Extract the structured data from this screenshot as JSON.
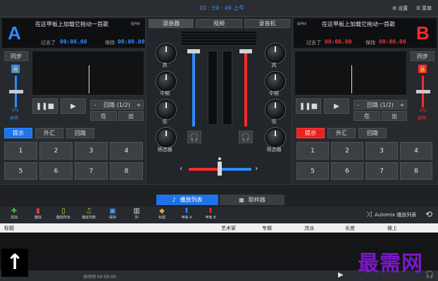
{
  "topbar": {
    "time": "10 : 59 : 49 上午",
    "settings_label": "设置",
    "menu_label": "菜单"
  },
  "deckA": {
    "letter": "A",
    "title": "在这甲板上加载它拖动一首歌",
    "bpm": "BPM",
    "elapsed_label": "过去了",
    "elapsed": "00:00.00",
    "remain_label": "保持",
    "remain": "00:00.00",
    "sync_label": "同步",
    "pitch": "0%",
    "pitch_label": "球场",
    "loop_label": "回路 (1/2)",
    "minus": "-",
    "plus": "+",
    "in_label": "在",
    "out_label": "出",
    "tabs": [
      "提示",
      "外汇",
      "回路"
    ],
    "pads": [
      "1",
      "2",
      "3",
      "4",
      "5",
      "6",
      "7",
      "8"
    ]
  },
  "deckB": {
    "letter": "B",
    "title": "在这甲板上加载它拖动一首歌",
    "bpm": "BPM",
    "elapsed_label": "过去了",
    "elapsed": "00:00.00",
    "remain_label": "保持",
    "remain": "00:00.00",
    "sync_label": "同步",
    "pitch": "0%",
    "pitch_label": "球场",
    "loop_label": "回路 (1/2)",
    "minus": "-",
    "plus": "+",
    "in_label": "在",
    "out_label": "出",
    "tabs": [
      "提示",
      "外汇",
      "回路"
    ],
    "pads": [
      "1",
      "2",
      "3",
      "4",
      "5",
      "6",
      "7",
      "8"
    ]
  },
  "mixer": {
    "tabs": [
      "混音器",
      "视频",
      "录音机"
    ],
    "knobs": [
      "高",
      "中期",
      "低",
      "筛选器"
    ]
  },
  "browser": {
    "tabs": [
      "播放列表",
      "取样器"
    ],
    "toolbar": [
      "添加",
      "删除",
      "删除所有",
      "播放列表",
      "保存",
      "列",
      "标题",
      "甲板 A",
      "甲板 B"
    ],
    "automix_label": "Automix 播放列表",
    "columns": [
      "标题",
      "艺术家",
      "专辑",
      "流派",
      "长度",
      "被上"
    ],
    "total_label": "总时间 00:00:00"
  },
  "watermark": "最需网",
  "colors": {
    "deckA": "#2f8bff",
    "deckB": "#ff2b2b",
    "bg": "#1b1d20"
  }
}
